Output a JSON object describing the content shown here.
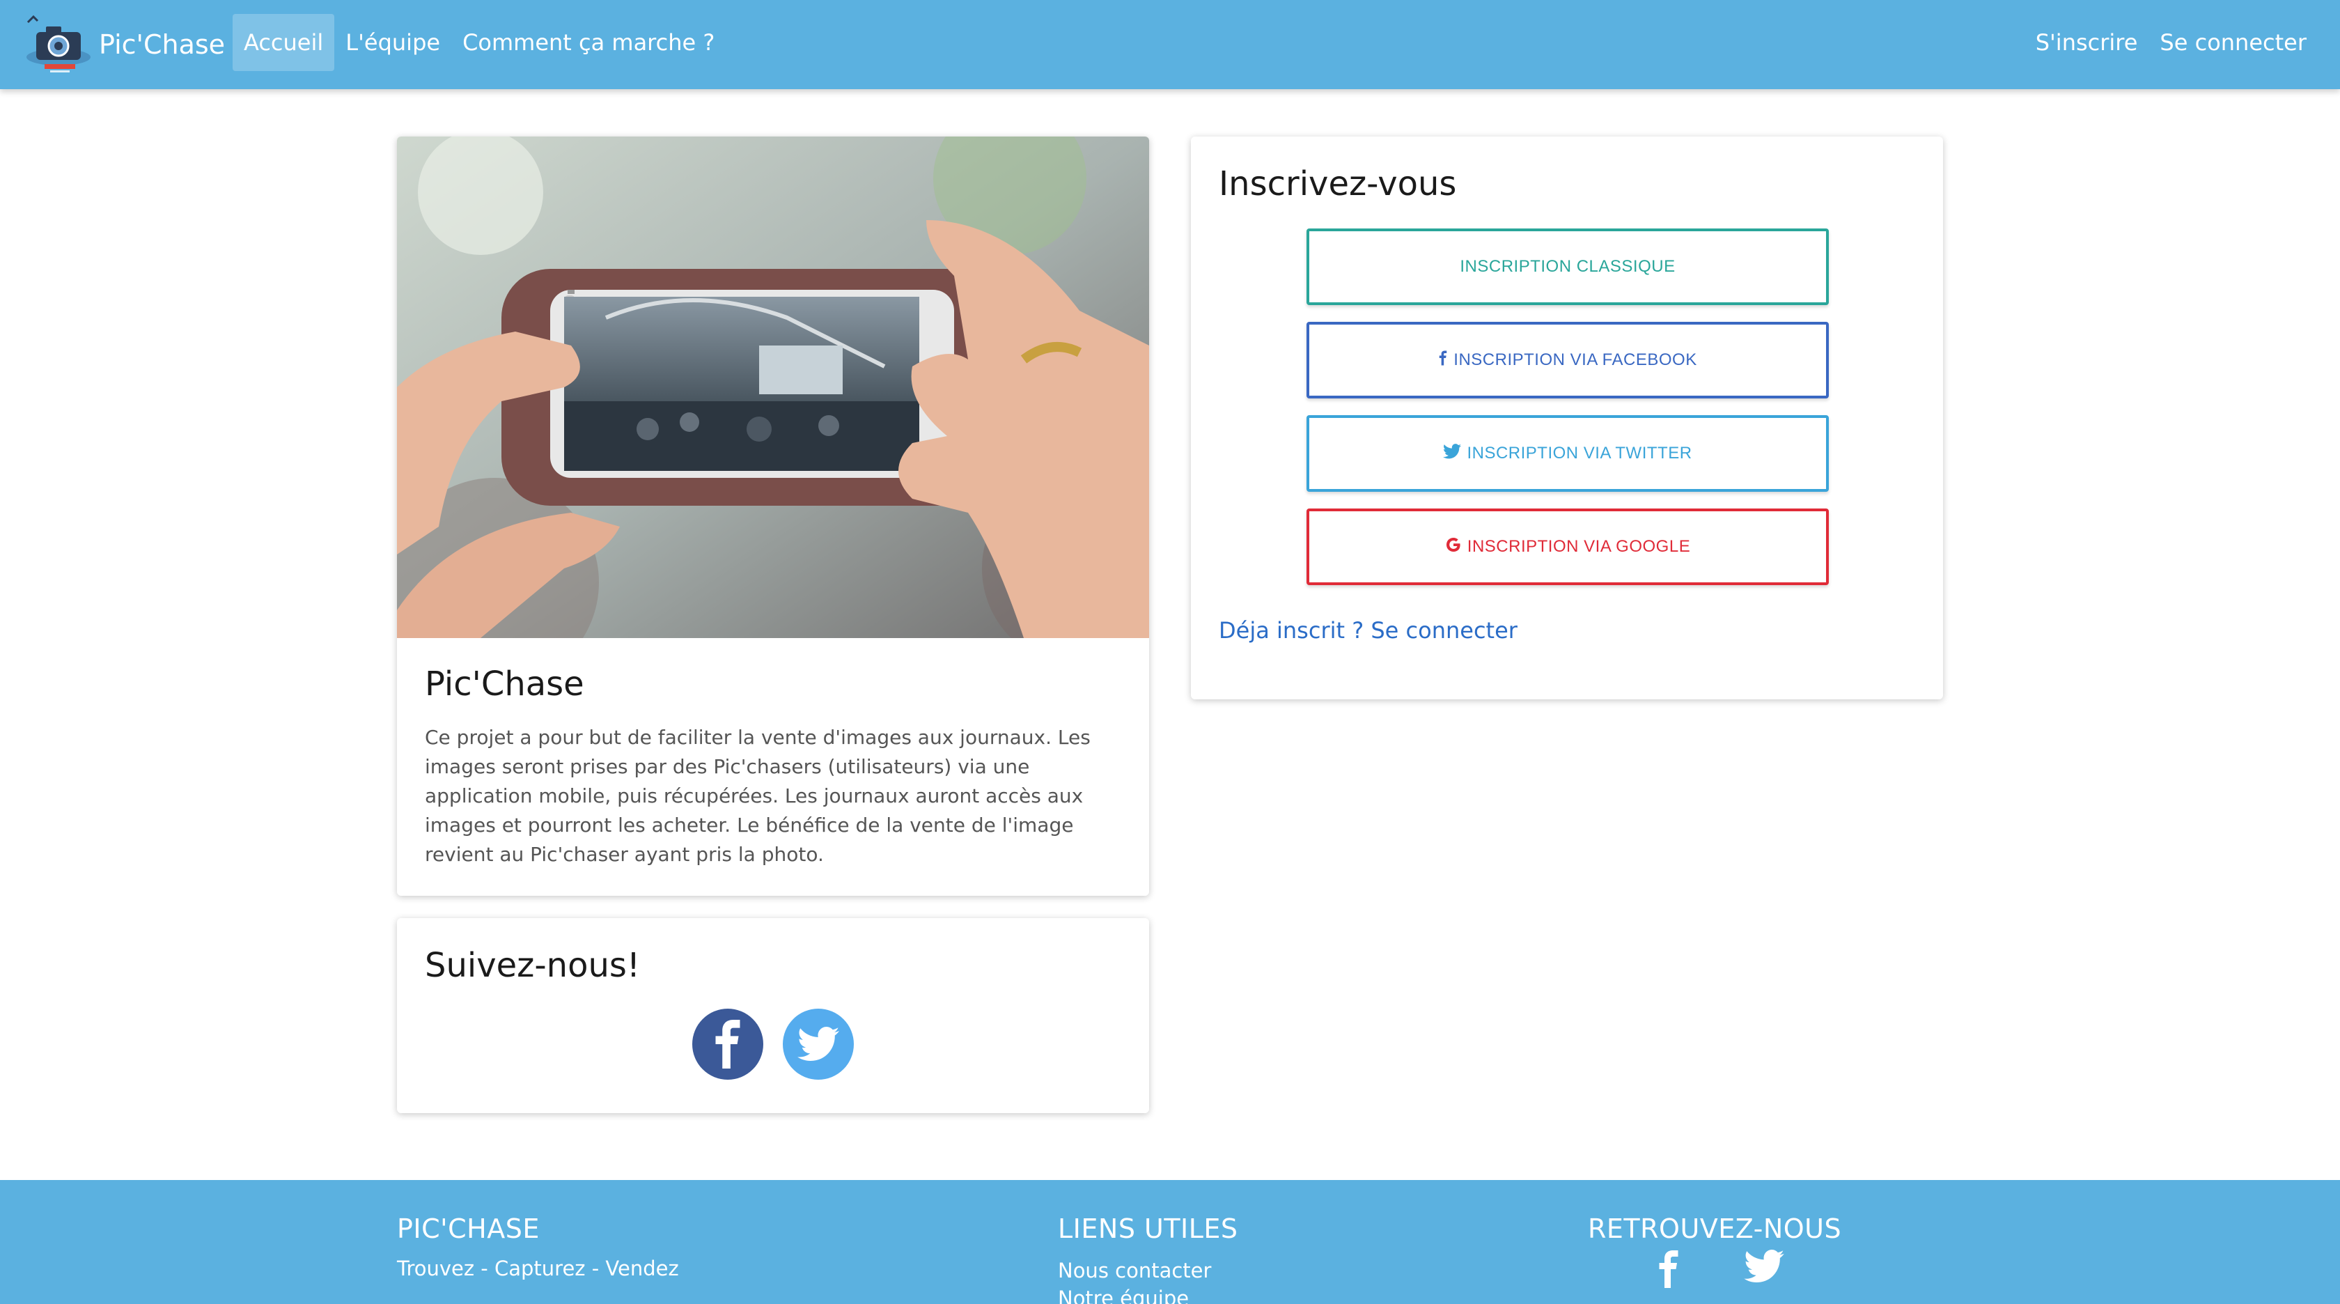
{
  "navbar": {
    "brand": "Pic'Chase",
    "links": [
      {
        "label": "Accueil",
        "active": true
      },
      {
        "label": "L'équipe",
        "active": false
      },
      {
        "label": "Comment ça marche ?",
        "active": false
      }
    ],
    "right_links": [
      {
        "label": "S'inscrire"
      },
      {
        "label": "Se connecter"
      }
    ]
  },
  "intro": {
    "title": "Pic'Chase",
    "text": "Ce projet a pour but de faciliter la vente d'images aux journaux. Les images seront prises par des Pic'chasers (utilisateurs) via une application mobile, puis récupérées. Les journaux auront accès aux images et pourront les acheter. Le bénéfice de la vente de l'image revient au Pic'chaser ayant pris la photo."
  },
  "follow": {
    "title": "Suivez-nous!",
    "icons": [
      "facebook-icon",
      "twitter-icon"
    ]
  },
  "signup": {
    "title": "Inscrivez-vous",
    "buttons": {
      "classic": "INSCRIPTION CLASSIQUE",
      "facebook": "INSCRIPTION VIA FACEBOOK",
      "twitter": "INSCRIPTION VIA TWITTER",
      "google": "INSCRIPTION VIA GOOGLE"
    },
    "login_link": "Déja inscrit ? Se connecter"
  },
  "footer": {
    "col1": {
      "title": "PIC'CHASE",
      "text": "Trouvez - Capturez - Vendez"
    },
    "col2": {
      "title": "LIENS UTILES",
      "links": [
        "Nous contacter",
        "Notre équipe"
      ]
    },
    "col3": {
      "title": "RETROUVEZ-NOUS",
      "icons": [
        "facebook-icon",
        "twitter-icon"
      ]
    }
  },
  "colors": {
    "navbar": "#5bb1e0",
    "classic": "#2aa69a",
    "facebook": "#3a68c2",
    "twitter": "#3aa4d9",
    "google": "#e02b38",
    "link": "#2a6cc7"
  }
}
